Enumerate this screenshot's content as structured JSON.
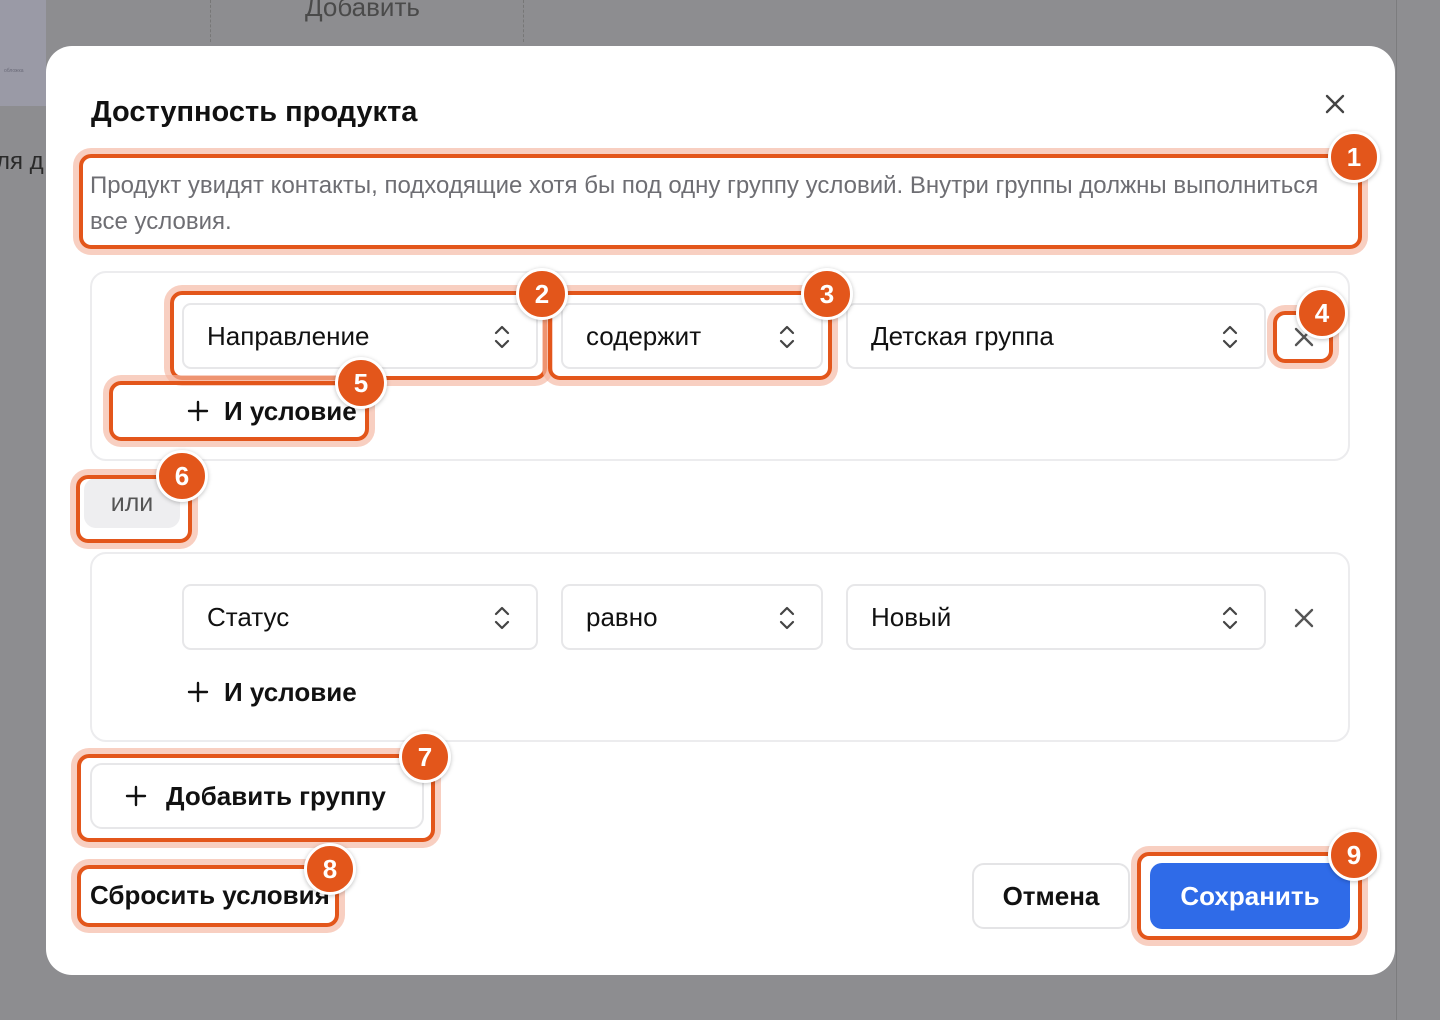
{
  "background": {
    "add_label": "Добавить",
    "side_text": "ля д",
    "thumb_text": "обложка"
  },
  "dialog": {
    "title": "Доступность продукта",
    "description": "Продукт увидят контакты, подходящие хотя бы под одну группу условий. Внутри группы должны выполниться все условия.",
    "groups": [
      {
        "conditions": [
          {
            "field": "Направление",
            "operator": "содержит",
            "value": "Детская группа"
          }
        ],
        "and_label": "И условие"
      },
      {
        "conditions": [
          {
            "field": "Статус",
            "operator": "равно",
            "value": "Новый"
          }
        ],
        "and_label": "И условие"
      }
    ],
    "or_label": "или",
    "add_group_label": "Добавить группу",
    "reset_label": "Сбросить условия",
    "cancel_label": "Отмена",
    "save_label": "Сохранить"
  },
  "annotations": [
    "1",
    "2",
    "3",
    "4",
    "5",
    "6",
    "7",
    "8",
    "9"
  ],
  "colors": {
    "accent": "#2f6be8",
    "annotation": "#e3561b",
    "overlay": "#8e8e91"
  },
  "icons": {
    "close": "close-icon",
    "select_arrows": "chevron-up-down-icon",
    "remove_condition": "close-icon",
    "add": "plus-icon"
  }
}
